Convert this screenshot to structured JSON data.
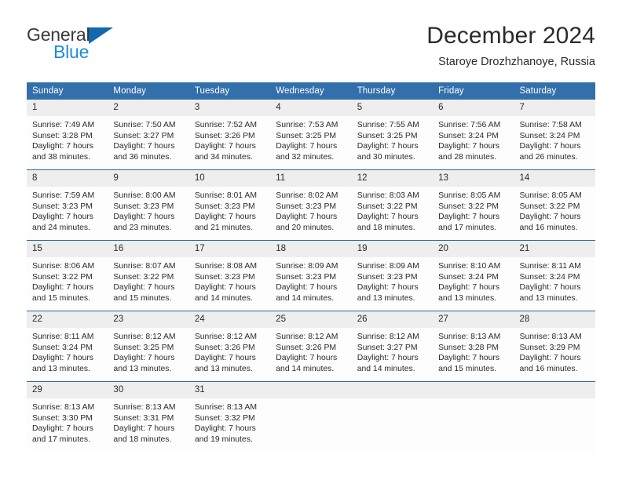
{
  "brand": {
    "name_part1": "General",
    "name_part2": "Blue",
    "colors": {
      "dark": "#3a3a3a",
      "blue": "#1e8bd6",
      "triangle": "#1269b0"
    }
  },
  "header": {
    "title": "December 2024",
    "subtitle": "Staroye Drozhzhanoye, Russia"
  },
  "theme": {
    "header_blue": "#336fab",
    "row_divider": "#2a6ba8",
    "daynum_band": "#eeeeee",
    "cell_bg": "#fdfdfd",
    "text": "#2b2b2b"
  },
  "calendar": {
    "weekday_headers": [
      "Sunday",
      "Monday",
      "Tuesday",
      "Wednesday",
      "Thursday",
      "Friday",
      "Saturday"
    ],
    "weeks": [
      [
        {
          "day": "1",
          "sunrise": "Sunrise: 7:49 AM",
          "sunset": "Sunset: 3:28 PM",
          "daylight_1": "Daylight: 7 hours",
          "daylight_2": "and 38 minutes."
        },
        {
          "day": "2",
          "sunrise": "Sunrise: 7:50 AM",
          "sunset": "Sunset: 3:27 PM",
          "daylight_1": "Daylight: 7 hours",
          "daylight_2": "and 36 minutes."
        },
        {
          "day": "3",
          "sunrise": "Sunrise: 7:52 AM",
          "sunset": "Sunset: 3:26 PM",
          "daylight_1": "Daylight: 7 hours",
          "daylight_2": "and 34 minutes."
        },
        {
          "day": "4",
          "sunrise": "Sunrise: 7:53 AM",
          "sunset": "Sunset: 3:25 PM",
          "daylight_1": "Daylight: 7 hours",
          "daylight_2": "and 32 minutes."
        },
        {
          "day": "5",
          "sunrise": "Sunrise: 7:55 AM",
          "sunset": "Sunset: 3:25 PM",
          "daylight_1": "Daylight: 7 hours",
          "daylight_2": "and 30 minutes."
        },
        {
          "day": "6",
          "sunrise": "Sunrise: 7:56 AM",
          "sunset": "Sunset: 3:24 PM",
          "daylight_1": "Daylight: 7 hours",
          "daylight_2": "and 28 minutes."
        },
        {
          "day": "7",
          "sunrise": "Sunrise: 7:58 AM",
          "sunset": "Sunset: 3:24 PM",
          "daylight_1": "Daylight: 7 hours",
          "daylight_2": "and 26 minutes."
        }
      ],
      [
        {
          "day": "8",
          "sunrise": "Sunrise: 7:59 AM",
          "sunset": "Sunset: 3:23 PM",
          "daylight_1": "Daylight: 7 hours",
          "daylight_2": "and 24 minutes."
        },
        {
          "day": "9",
          "sunrise": "Sunrise: 8:00 AM",
          "sunset": "Sunset: 3:23 PM",
          "daylight_1": "Daylight: 7 hours",
          "daylight_2": "and 23 minutes."
        },
        {
          "day": "10",
          "sunrise": "Sunrise: 8:01 AM",
          "sunset": "Sunset: 3:23 PM",
          "daylight_1": "Daylight: 7 hours",
          "daylight_2": "and 21 minutes."
        },
        {
          "day": "11",
          "sunrise": "Sunrise: 8:02 AM",
          "sunset": "Sunset: 3:23 PM",
          "daylight_1": "Daylight: 7 hours",
          "daylight_2": "and 20 minutes."
        },
        {
          "day": "12",
          "sunrise": "Sunrise: 8:03 AM",
          "sunset": "Sunset: 3:22 PM",
          "daylight_1": "Daylight: 7 hours",
          "daylight_2": "and 18 minutes."
        },
        {
          "day": "13",
          "sunrise": "Sunrise: 8:05 AM",
          "sunset": "Sunset: 3:22 PM",
          "daylight_1": "Daylight: 7 hours",
          "daylight_2": "and 17 minutes."
        },
        {
          "day": "14",
          "sunrise": "Sunrise: 8:05 AM",
          "sunset": "Sunset: 3:22 PM",
          "daylight_1": "Daylight: 7 hours",
          "daylight_2": "and 16 minutes."
        }
      ],
      [
        {
          "day": "15",
          "sunrise": "Sunrise: 8:06 AM",
          "sunset": "Sunset: 3:22 PM",
          "daylight_1": "Daylight: 7 hours",
          "daylight_2": "and 15 minutes."
        },
        {
          "day": "16",
          "sunrise": "Sunrise: 8:07 AM",
          "sunset": "Sunset: 3:22 PM",
          "daylight_1": "Daylight: 7 hours",
          "daylight_2": "and 15 minutes."
        },
        {
          "day": "17",
          "sunrise": "Sunrise: 8:08 AM",
          "sunset": "Sunset: 3:23 PM",
          "daylight_1": "Daylight: 7 hours",
          "daylight_2": "and 14 minutes."
        },
        {
          "day": "18",
          "sunrise": "Sunrise: 8:09 AM",
          "sunset": "Sunset: 3:23 PM",
          "daylight_1": "Daylight: 7 hours",
          "daylight_2": "and 14 minutes."
        },
        {
          "day": "19",
          "sunrise": "Sunrise: 8:09 AM",
          "sunset": "Sunset: 3:23 PM",
          "daylight_1": "Daylight: 7 hours",
          "daylight_2": "and 13 minutes."
        },
        {
          "day": "20",
          "sunrise": "Sunrise: 8:10 AM",
          "sunset": "Sunset: 3:24 PM",
          "daylight_1": "Daylight: 7 hours",
          "daylight_2": "and 13 minutes."
        },
        {
          "day": "21",
          "sunrise": "Sunrise: 8:11 AM",
          "sunset": "Sunset: 3:24 PM",
          "daylight_1": "Daylight: 7 hours",
          "daylight_2": "and 13 minutes."
        }
      ],
      [
        {
          "day": "22",
          "sunrise": "Sunrise: 8:11 AM",
          "sunset": "Sunset: 3:24 PM",
          "daylight_1": "Daylight: 7 hours",
          "daylight_2": "and 13 minutes."
        },
        {
          "day": "23",
          "sunrise": "Sunrise: 8:12 AM",
          "sunset": "Sunset: 3:25 PM",
          "daylight_1": "Daylight: 7 hours",
          "daylight_2": "and 13 minutes."
        },
        {
          "day": "24",
          "sunrise": "Sunrise: 8:12 AM",
          "sunset": "Sunset: 3:26 PM",
          "daylight_1": "Daylight: 7 hours",
          "daylight_2": "and 13 minutes."
        },
        {
          "day": "25",
          "sunrise": "Sunrise: 8:12 AM",
          "sunset": "Sunset: 3:26 PM",
          "daylight_1": "Daylight: 7 hours",
          "daylight_2": "and 14 minutes."
        },
        {
          "day": "26",
          "sunrise": "Sunrise: 8:12 AM",
          "sunset": "Sunset: 3:27 PM",
          "daylight_1": "Daylight: 7 hours",
          "daylight_2": "and 14 minutes."
        },
        {
          "day": "27",
          "sunrise": "Sunrise: 8:13 AM",
          "sunset": "Sunset: 3:28 PM",
          "daylight_1": "Daylight: 7 hours",
          "daylight_2": "and 15 minutes."
        },
        {
          "day": "28",
          "sunrise": "Sunrise: 8:13 AM",
          "sunset": "Sunset: 3:29 PM",
          "daylight_1": "Daylight: 7 hours",
          "daylight_2": "and 16 minutes."
        }
      ],
      [
        {
          "day": "29",
          "sunrise": "Sunrise: 8:13 AM",
          "sunset": "Sunset: 3:30 PM",
          "daylight_1": "Daylight: 7 hours",
          "daylight_2": "and 17 minutes."
        },
        {
          "day": "30",
          "sunrise": "Sunrise: 8:13 AM",
          "sunset": "Sunset: 3:31 PM",
          "daylight_1": "Daylight: 7 hours",
          "daylight_2": "and 18 minutes."
        },
        {
          "day": "31",
          "sunrise": "Sunrise: 8:13 AM",
          "sunset": "Sunset: 3:32 PM",
          "daylight_1": "Daylight: 7 hours",
          "daylight_2": "and 19 minutes."
        },
        {
          "day": "",
          "sunrise": "",
          "sunset": "",
          "daylight_1": "",
          "daylight_2": ""
        },
        {
          "day": "",
          "sunrise": "",
          "sunset": "",
          "daylight_1": "",
          "daylight_2": ""
        },
        {
          "day": "",
          "sunrise": "",
          "sunset": "",
          "daylight_1": "",
          "daylight_2": ""
        },
        {
          "day": "",
          "sunrise": "",
          "sunset": "",
          "daylight_1": "",
          "daylight_2": ""
        }
      ]
    ]
  }
}
